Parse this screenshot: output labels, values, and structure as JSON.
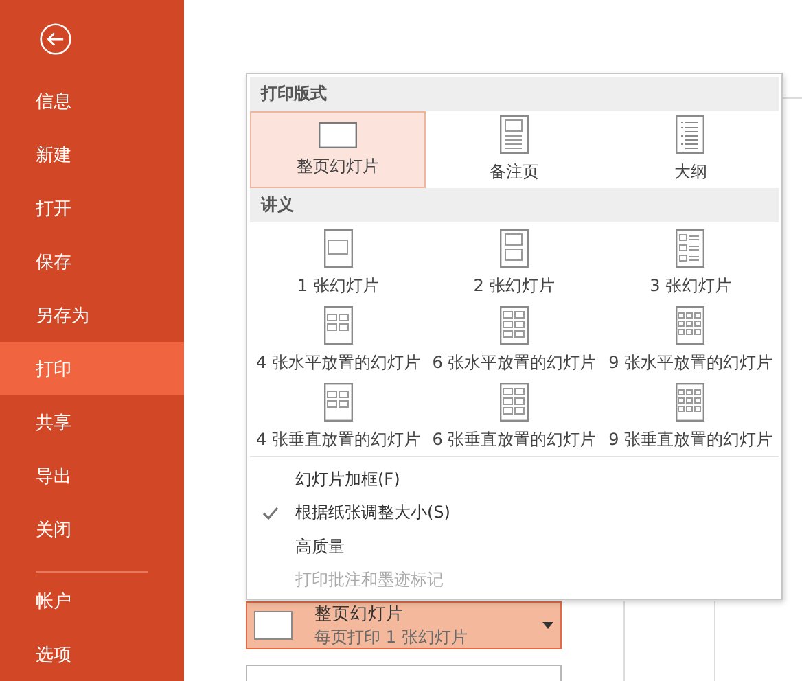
{
  "sidebar": {
    "items": [
      {
        "label": "信息",
        "selected": false
      },
      {
        "label": "新建",
        "selected": false
      },
      {
        "label": "打开",
        "selected": false
      },
      {
        "label": "保存",
        "selected": false
      },
      {
        "label": "另存为",
        "selected": false
      },
      {
        "label": "打印",
        "selected": true
      },
      {
        "label": "共享",
        "selected": false
      },
      {
        "label": "导出",
        "selected": false
      },
      {
        "label": "关闭",
        "selected": false
      }
    ],
    "footer_items": [
      {
        "label": "帐户",
        "selected": false
      },
      {
        "label": "选项",
        "selected": false
      }
    ]
  },
  "layout_menu": {
    "sections": [
      {
        "title": "打印版式",
        "options": [
          {
            "label": "整页幻灯片",
            "kind": "full",
            "selected": true
          },
          {
            "label": "备注页",
            "kind": "notes",
            "selected": false
          },
          {
            "label": "大纲",
            "kind": "outline",
            "selected": false
          }
        ]
      },
      {
        "title": "讲义",
        "options": [
          {
            "label": "1 张幻灯片",
            "kind": "h1",
            "selected": false
          },
          {
            "label": "2 张幻灯片",
            "kind": "h2",
            "selected": false
          },
          {
            "label": "3 张幻灯片",
            "kind": "h3",
            "selected": false
          },
          {
            "label": "4 张水平放置的幻灯片",
            "kind": "h4",
            "selected": false
          },
          {
            "label": "6 张水平放置的幻灯片",
            "kind": "h6",
            "selected": false
          },
          {
            "label": "9 张水平放置的幻灯片",
            "kind": "h9",
            "selected": false
          },
          {
            "label": "4 张垂直放置的幻灯片",
            "kind": "h4",
            "selected": false
          },
          {
            "label": "6 张垂直放置的幻灯片",
            "kind": "h6",
            "selected": false
          },
          {
            "label": "9 张垂直放置的幻灯片",
            "kind": "h9",
            "selected": false
          }
        ]
      }
    ],
    "toggles": [
      {
        "label": "幻灯片加框(F)",
        "checked": false,
        "disabled": false
      },
      {
        "label": "根据纸张调整大小(S)",
        "checked": true,
        "disabled": false
      },
      {
        "label": "高质量",
        "checked": false,
        "disabled": false
      },
      {
        "label": "打印批注和墨迹标记",
        "checked": false,
        "disabled": true
      }
    ]
  },
  "layout_dropdown": {
    "title": "整页幻灯片",
    "subtitle": "每页打印 1 张幻灯片"
  }
}
